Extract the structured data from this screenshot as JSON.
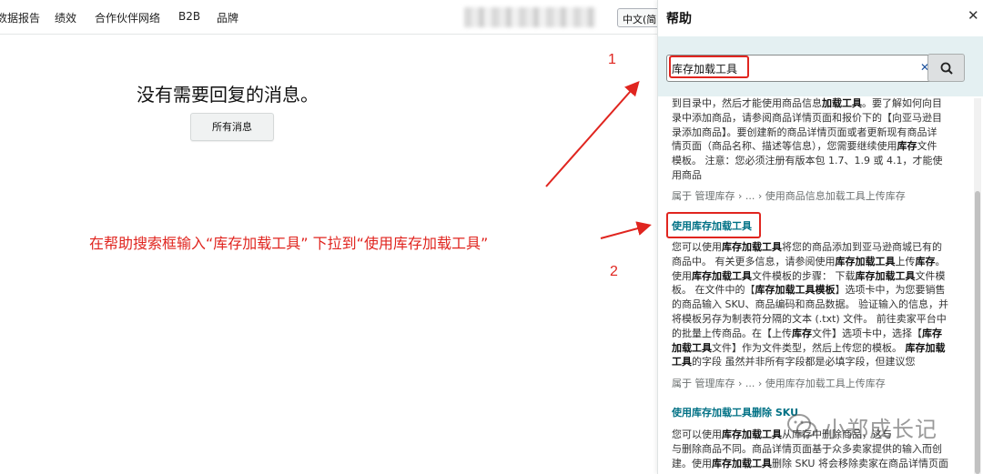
{
  "nav": {
    "items": [
      "数据报告",
      "绩效",
      "合作伙伴网络",
      "B2B",
      "品牌"
    ],
    "language": "中文(简"
  },
  "main": {
    "no_messages": "没有需要回复的消息。",
    "all_messages_button": "所有消息"
  },
  "annotation": {
    "step1": "1",
    "step2": "2",
    "instruction": "在帮助搜索框输入“库存加载工具” 下拉到“使用库存加载工具”",
    "color": "#e0251f"
  },
  "help": {
    "title": "帮助",
    "close_icon": "close-icon",
    "search_value": "库存加载工具",
    "search_icon": "search-icon",
    "results": {
      "r1_snippet_lines": [
        "到目录中，然后才能使用商品信息<b>加载工具</b>。要了解如何向目",
        "录中添加商品，请参阅商品详情页面和报价下的【向亚马逊目",
        "录添加商品】。要创建新的商品详情页面或者更新现有商品详",
        "情页面（商品名称、描述等信息），您需要继续使用<b>库存</b>文件",
        "模板。 注意：您必须注册有版本包 1.7、1.9 或 4.1，才能使",
        "用商品"
      ],
      "r1_breadcrumb": "属于 管理库存 › ... › 使用商品信息加载工具上传库存",
      "r2_title": "使用库存加载工具",
      "r2_snippet_lines": [
        "您可以使用<b>库存加载工具</b>将您的商品添加到亚马逊商城已有的",
        "商品中。 有关更多信息，请参阅使用<b>库存加载工具</b>上传<b>库存</b>。",
        "使用<b>库存加载工具</b>文件模板的步骤： 下载<b>库存加载工具</b>文件模",
        "板。 在文件中的【<b>库存加载工具模板</b>】选项卡中，为您要销售",
        "的商品输入 SKU、商品编码和商品数据。 验证输入的信息，并",
        "将模板另存为制表符分隔的文本 (.txt) 文件。 前往卖家平台中",
        "的批量上传商品。在【上传<b>库存</b>文件】选项卡中，选择【<b>库存</b>",
        "<b>加载工具</b>文件】作为文件类型，然后上传您的模板。 <b>库存加载</b>",
        "<b>工具</b>的字段 虽然并非所有字段都是必填字段，但建议您"
      ],
      "r2_breadcrumb": "属于 管理库存 › ... › 使用库存加载工具上传库存",
      "r3_title": "使用库存加载工具删除 SKU",
      "r3_snippet_lines": [
        "您可以使用<b>库存加载工具</b>从库存中删除商品，这与",
        "与删除商品不同。商品详情页面基于众多卖家提供的输入而创",
        "建。使用<b>库存加载工具</b>删除 SKU 将会移除卖家在商品详情页面"
      ]
    }
  },
  "watermark": "小郑成长记",
  "colors": {
    "link": "#007185",
    "search_band": "#e4f0f2",
    "annotation_red": "#e0251f"
  }
}
